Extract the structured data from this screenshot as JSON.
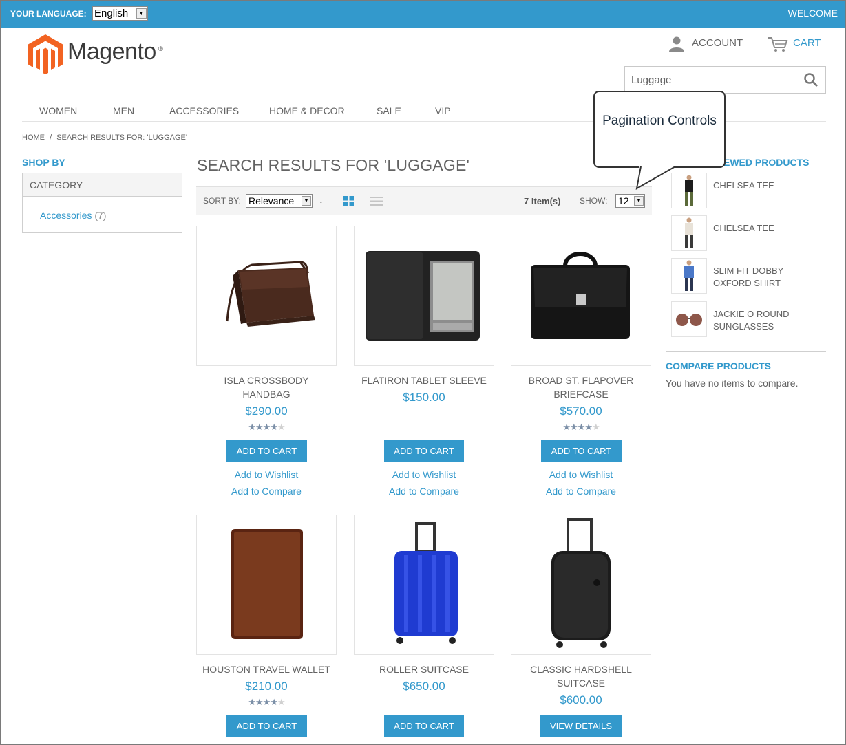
{
  "topbar": {
    "language_label": "YOUR LANGUAGE:",
    "language_value": "English",
    "welcome": "WELCOME"
  },
  "header": {
    "logo_text": "Magento",
    "logo_mark": "®",
    "account": "ACCOUNT",
    "cart": "CART",
    "search_value": "Luggage"
  },
  "nav": [
    "WOMEN",
    "MEN",
    "ACCESSORIES",
    "HOME & DECOR",
    "SALE",
    "VIP"
  ],
  "breadcrumb": {
    "home": "HOME",
    "sep": "/",
    "current": "SEARCH RESULTS FOR: 'LUGGAGE'"
  },
  "sidebar": {
    "title": "SHOP BY",
    "category_header": "CATEGORY",
    "category_link": "Accessories",
    "category_count": "(7)"
  },
  "main": {
    "title": "SEARCH RESULTS FOR 'LUGGAGE'",
    "sort_label": "SORT BY:",
    "sort_value": "Relevance",
    "sort_dir": "↓",
    "items_count": "7 Item(s)",
    "show_label": "SHOW:",
    "show_value": "12"
  },
  "products": [
    {
      "name": "ISLA CROSSBODY HANDBAG",
      "price": "$290.00",
      "rating": 4.5,
      "button": "ADD TO CART",
      "wishlist": "Add to Wishlist",
      "compare": "Add to Compare"
    },
    {
      "name": "FLATIRON TABLET SLEEVE",
      "price": "$150.00",
      "rating": null,
      "button": "ADD TO CART",
      "wishlist": "Add to Wishlist",
      "compare": "Add to Compare"
    },
    {
      "name": "BROAD ST. FLAPOVER BRIEFCASE",
      "price": "$570.00",
      "rating": 4.5,
      "button": "ADD TO CART",
      "wishlist": "Add to Wishlist",
      "compare": "Add to Compare"
    },
    {
      "name": "HOUSTON TRAVEL WALLET",
      "price": "$210.00",
      "rating": 4,
      "button": "ADD TO CART"
    },
    {
      "name": "ROLLER SUITCASE",
      "price": "$650.00",
      "rating": null,
      "button": "ADD TO CART"
    },
    {
      "name": "CLASSIC HARDSHELL SUITCASE",
      "price": "$600.00",
      "rating": null,
      "button": "VIEW DETAILS"
    }
  ],
  "recently_viewed": {
    "title": "EWED PRODUCTS",
    "items": [
      "CHELSEA TEE",
      "CHELSEA TEE",
      "SLIM FIT DOBBY OXFORD SHIRT",
      "JACKIE O ROUND SUNGLASSES"
    ]
  },
  "compare": {
    "title": "COMPARE PRODUCTS",
    "text": "You have no items to compare."
  },
  "callout": {
    "text": "Pagination Controls"
  },
  "colors": {
    "accent": "#3399cc",
    "text": "#636363",
    "logo_orange": "#f26322"
  }
}
